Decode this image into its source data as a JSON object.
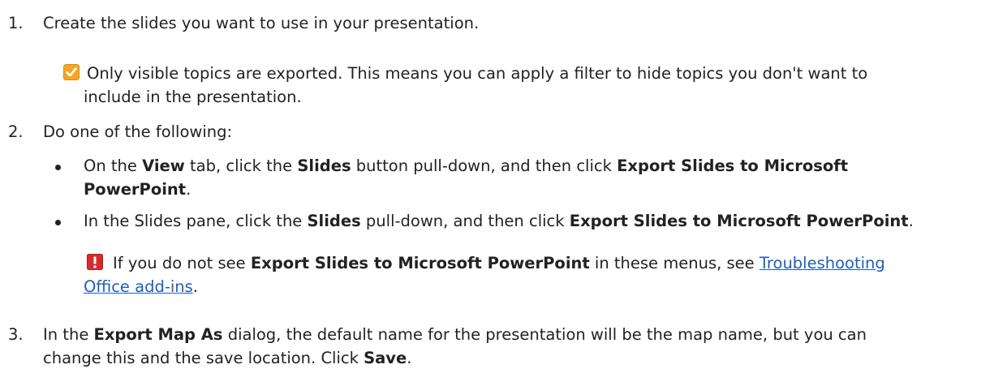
{
  "steps": [
    {
      "number": "1.",
      "text": "Create the slides you want to use in your presentation.",
      "note": {
        "icon": "checkmark-icon",
        "line1": "Only visible topics are exported. This means you can apply a filter to hide topics you don't want to",
        "line2": "include in the presentation."
      }
    },
    {
      "number": "2.",
      "text": "Do one of the following:",
      "bullets": [
        {
          "pre": "On the ",
          "b1": "View",
          "mid1": " tab, click the ",
          "b2": "Slides",
          "mid2": " button pull-down, and then click ",
          "b3": "Export Slides to Microsoft",
          "line2_b": "PowerPoint",
          "line2_end": "."
        },
        {
          "pre": "In the Slides pane, click the ",
          "b1": "Slides",
          "mid1": " pull-down, and then click ",
          "b2": "Export Slides to Microsoft PowerPoint",
          "end": "."
        }
      ],
      "warning": {
        "icon": "exclamation-icon",
        "pre": "If you do not see ",
        "bold": "Export Slides to Microsoft PowerPoint",
        "mid": " in these menus, see ",
        "link_line1": "Troubleshooting",
        "link_line2": "Office add-ins",
        "end": "."
      }
    },
    {
      "number": "3.",
      "pre": "In the ",
      "bold": "Export Map As",
      "mid": " dialog, the default name for the presentation will be the map name, but you can",
      "line2_pre": "change this and the save location. Click ",
      "line2_bold": "Save",
      "line2_end": "."
    }
  ],
  "colors": {
    "checkmark": "#f5a623",
    "exclamation": "#d62b2b",
    "link": "#1f5fbf"
  }
}
